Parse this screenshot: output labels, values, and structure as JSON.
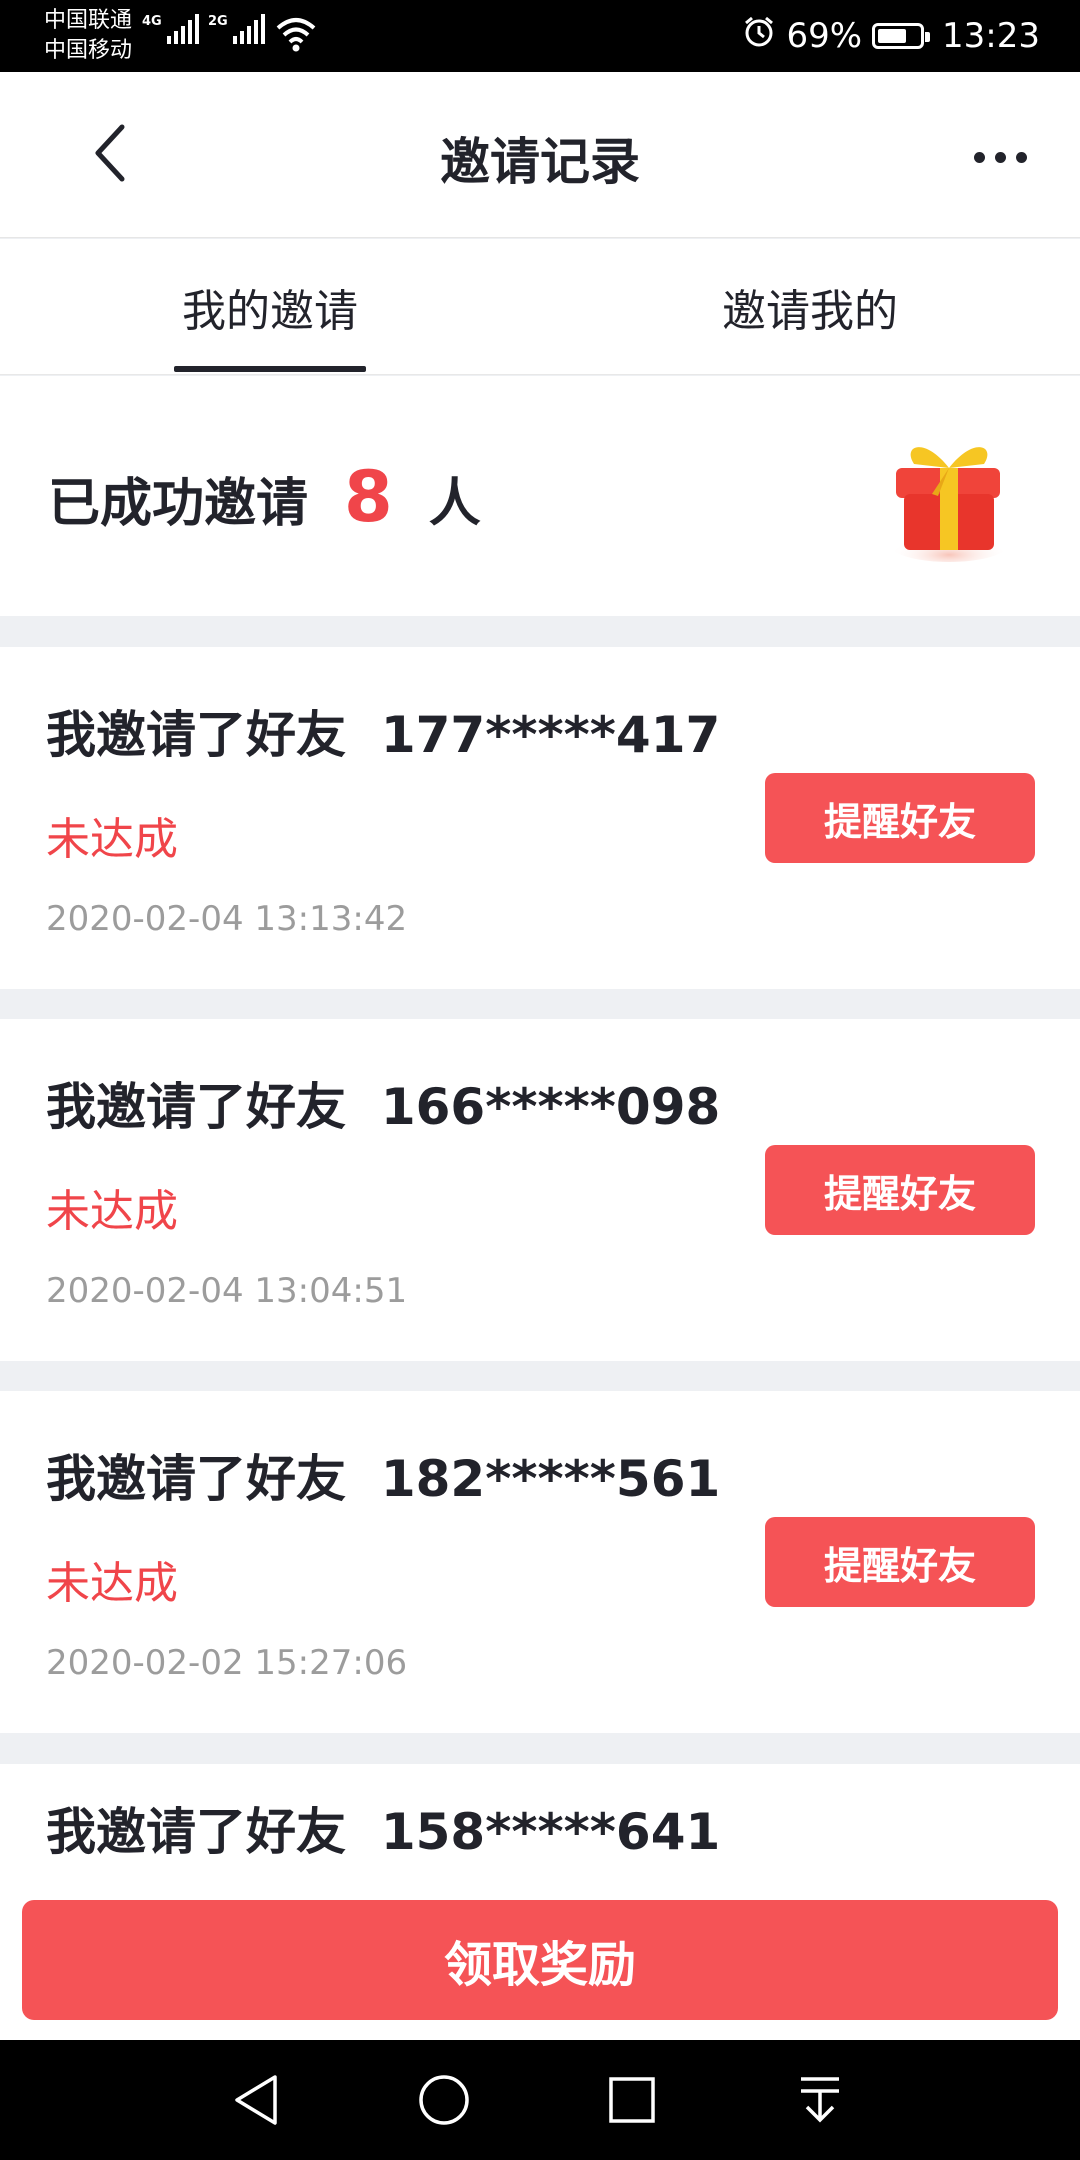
{
  "status_bar": {
    "carrier1": "中国联通",
    "carrier2": "中国移动",
    "net1": "4G",
    "net2": "2G",
    "battery": "69%",
    "battery_level": 0.69,
    "time": "13:23"
  },
  "header": {
    "title": "邀请记录"
  },
  "tabs": [
    {
      "label": "我的邀请",
      "active": true
    },
    {
      "label": "邀请我的",
      "active": false
    }
  ],
  "summary": {
    "prefix": "已成功邀请",
    "count": "8",
    "suffix": "人"
  },
  "invites": [
    {
      "title": "我邀请了好友",
      "phone": "177*****417",
      "status": "未达成",
      "time": "2020-02-04 13:13:42",
      "button": "提醒好友"
    },
    {
      "title": "我邀请了好友",
      "phone": "166*****098",
      "status": "未达成",
      "time": "2020-02-04 13:04:51",
      "button": "提醒好友"
    },
    {
      "title": "我邀请了好友",
      "phone": "182*****561",
      "status": "未达成",
      "time": "2020-02-02 15:27:06",
      "button": "提醒好友"
    },
    {
      "title": "我邀请了好友",
      "phone": "158*****641"
    }
  ],
  "footer": {
    "claim_label": "领取奖励"
  },
  "colors": {
    "accent": "#f55356",
    "count_red": "#f0454a",
    "text_dark": "#22232b",
    "text_gray": "#9c9c9c"
  },
  "icons": [
    "back-arrow-icon",
    "more-icon",
    "gift-icon",
    "alarm-icon",
    "wifi-icon",
    "signal-icon",
    "battery-icon",
    "nav-back-icon",
    "nav-home-icon",
    "nav-recents-icon",
    "nav-notifications-icon"
  ]
}
